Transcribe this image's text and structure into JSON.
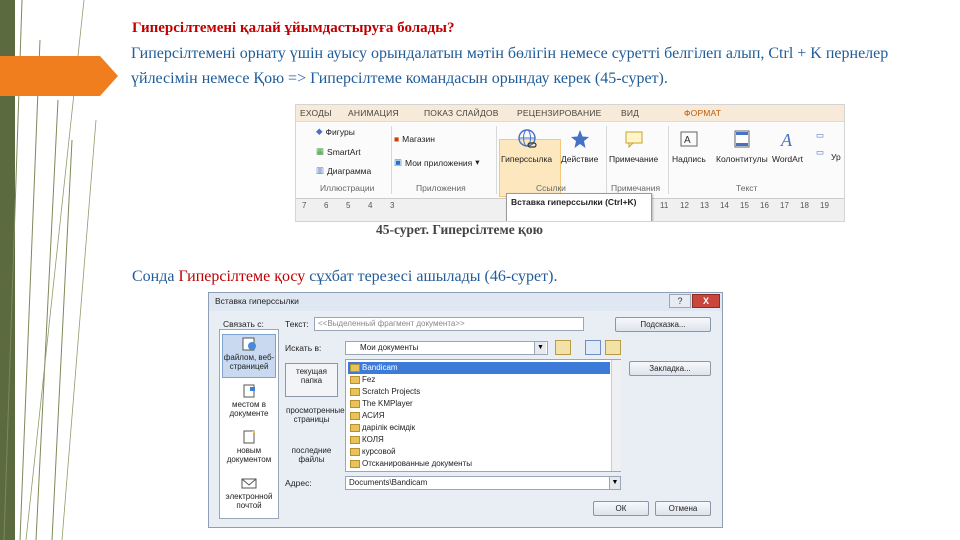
{
  "heading": "Гиперсілтемені қалай ұйымдастыруға болады?",
  "intro": "Гиперсілтемені орнату үшін ауысу орындалатын мәтін бөлігін немесе суретті белгілеп алып, Ctrl + K пернелер үйлесімін немесе Қою => Гиперсілтеме командасын орындау керек (45-сурет).",
  "figure1": {
    "caption": "45-сурет. Гиперсілтеме қою",
    "ribbon": {
      "tabs": [
        "ЕХОДЫ",
        "АНИМАЦИЯ",
        "ПОКАЗ СЛАЙДОВ",
        "РЕЦЕНЗИРОВАНИЕ",
        "ВИД",
        "ФОРМАТ"
      ],
      "buttons": {
        "figures": "Фигуры",
        "smartart": "SmartArt",
        "diagram": "Диаграмма",
        "store": "Магазин",
        "my_apps": "Мои приложения",
        "hyperlink": "Гиперссылка",
        "action": "Действие",
        "note": "Примечание",
        "caption": "Надпись",
        "header_footer": "Колонтитулы",
        "wordart": "WordArt",
        "more": "Ур"
      },
      "groups": [
        "Иллюстрации",
        "Приложения",
        "Ссылки",
        "Примечания",
        "Текст"
      ],
      "tooltip": "Вставка гиперссылки (Ctrl+K)",
      "ruler_left": [
        "7",
        "6",
        "5",
        "4",
        "3"
      ],
      "ruler_right": [
        "11",
        "12",
        "13",
        "14",
        "15",
        "16",
        "17",
        "18",
        "19"
      ]
    }
  },
  "sentence": {
    "before": "Сонда ",
    "highlight": "Гиперсілтеме қосу",
    "after": " сұхбат терезесі ашылады (46-сурет)."
  },
  "dialog": {
    "title": "Вставка гиперссылки",
    "help": "?",
    "close": "X",
    "link_to_label": "Связать с:",
    "text_label": "Текст:",
    "text_value": "<<Выделенный фрагмент документа>>",
    "tooltip_button": "Подсказка...",
    "look_in_label": "Искать в:",
    "look_in_value": "Мои документы",
    "bookmark_button": "Закладка...",
    "address_label": "Адрес:",
    "address_value": "Documents\\Bandicam",
    "ok_button": "ОК",
    "cancel_button": "Отмена",
    "link_items": [
      "файлом, веб-страницей",
      "местом в документе",
      "новым документом",
      "электронной почтой"
    ],
    "nav_buttons": [
      "текущая папка",
      "просмотренные страницы",
      "последние файлы"
    ],
    "files": [
      "Bandicam",
      "Fez",
      "Scratch Projects",
      "The KMPlayer",
      "АСИЯ",
      "дарілік өсімдік",
      "КОЛЯ",
      "курсовой",
      "Отсканированные документы"
    ]
  }
}
